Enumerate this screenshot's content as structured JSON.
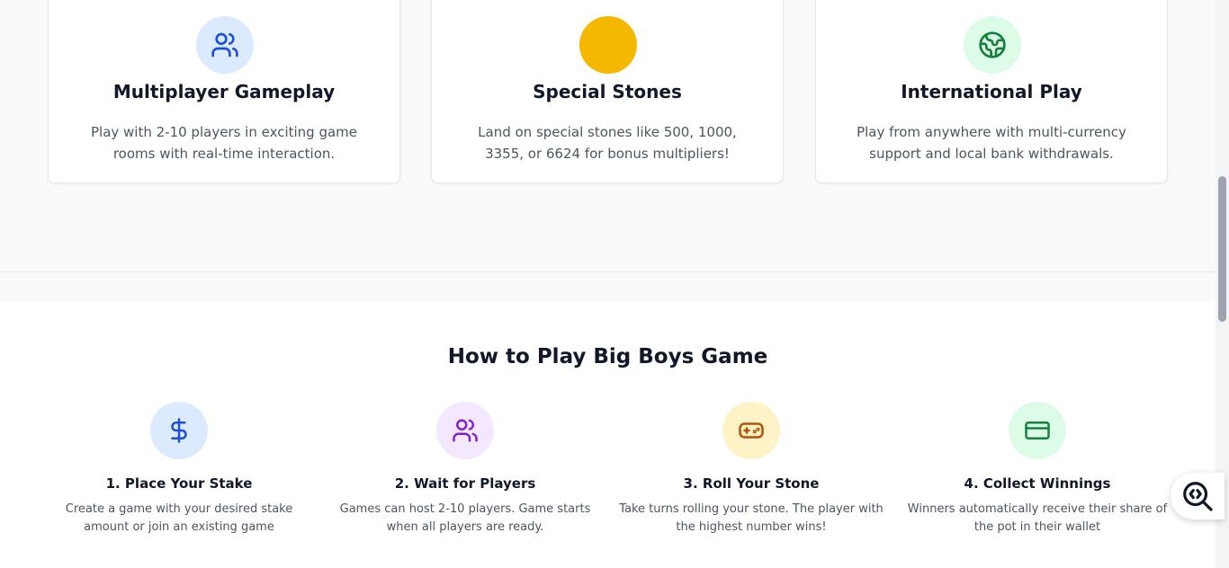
{
  "colors": {
    "blue_bg": "#dbeafe",
    "blue_fg": "#1d4ed8",
    "yellow": "#f5b800",
    "green_bg": "#dcfce7",
    "green_fg": "#15803d",
    "purple_bg": "#f3e8ff",
    "purple_fg": "#7e22ce",
    "amber_bg": "#fef3c7",
    "amber_fg": "#b45309",
    "accent_bar": "#b3124f"
  },
  "features": [
    {
      "icon": "users-icon",
      "title": "Multiplayer Gameplay",
      "desc": "Play with 2-10 players in exciting game rooms with real-time interaction."
    },
    {
      "icon": "yellow-circle-icon",
      "title": "Special Stones",
      "desc": "Land on special stones like 500, 1000, 3355, or 6624 for bonus multipliers!"
    },
    {
      "icon": "globe-icon",
      "title": "International Play",
      "desc": "Play from anywhere with multi-currency support and local bank withdrawals."
    }
  ],
  "how_to_play": {
    "title": "How to Play Big Boys Game",
    "steps": [
      {
        "icon": "dollar-icon",
        "title": "1. Place Your Stake",
        "desc": "Create a game with your desired stake amount or join an existing game"
      },
      {
        "icon": "users-icon",
        "title": "2. Wait for Players",
        "desc": "Games can host 2-10 players. Game starts when all players are ready."
      },
      {
        "icon": "gamepad-icon",
        "title": "3. Roll Your Stone",
        "desc": "Take turns rolling your stone. The player with the highest number wins!"
      },
      {
        "icon": "credit-card-icon",
        "title": "4. Collect Winnings",
        "desc": "Winners automatically receive their share of the pot in their wallet"
      }
    ]
  }
}
